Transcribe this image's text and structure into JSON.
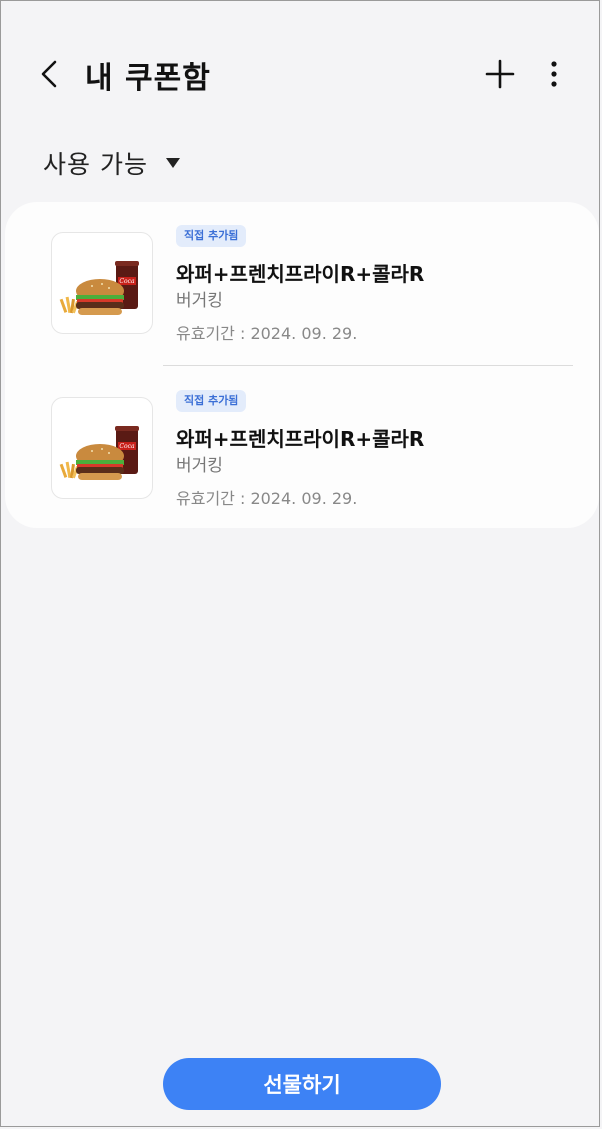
{
  "header": {
    "title": "내 쿠폰함",
    "back_icon": "chevron-left-icon",
    "add_icon": "plus-icon",
    "more_icon": "more-vertical-icon"
  },
  "filter": {
    "label": "사용 가능",
    "caret_icon": "caret-down-icon"
  },
  "coupons": [
    {
      "badge": "직접 추가됨",
      "name": "와퍼+프렌치프라이R+콜라R",
      "brand": "버거킹",
      "expiry": "유효기간 : 2024. 09. 29."
    },
    {
      "badge": "직접 추가됨",
      "name": "와퍼+프렌치프라이R+콜라R",
      "brand": "버거킹",
      "expiry": "유효기간 : 2024. 09. 29."
    }
  ],
  "footer": {
    "gift_label": "선물하기"
  },
  "colors": {
    "accent": "#3d82f5",
    "badge_bg": "#e3ecfb",
    "badge_text": "#3b6fd6",
    "background": "#f4f4f6"
  }
}
